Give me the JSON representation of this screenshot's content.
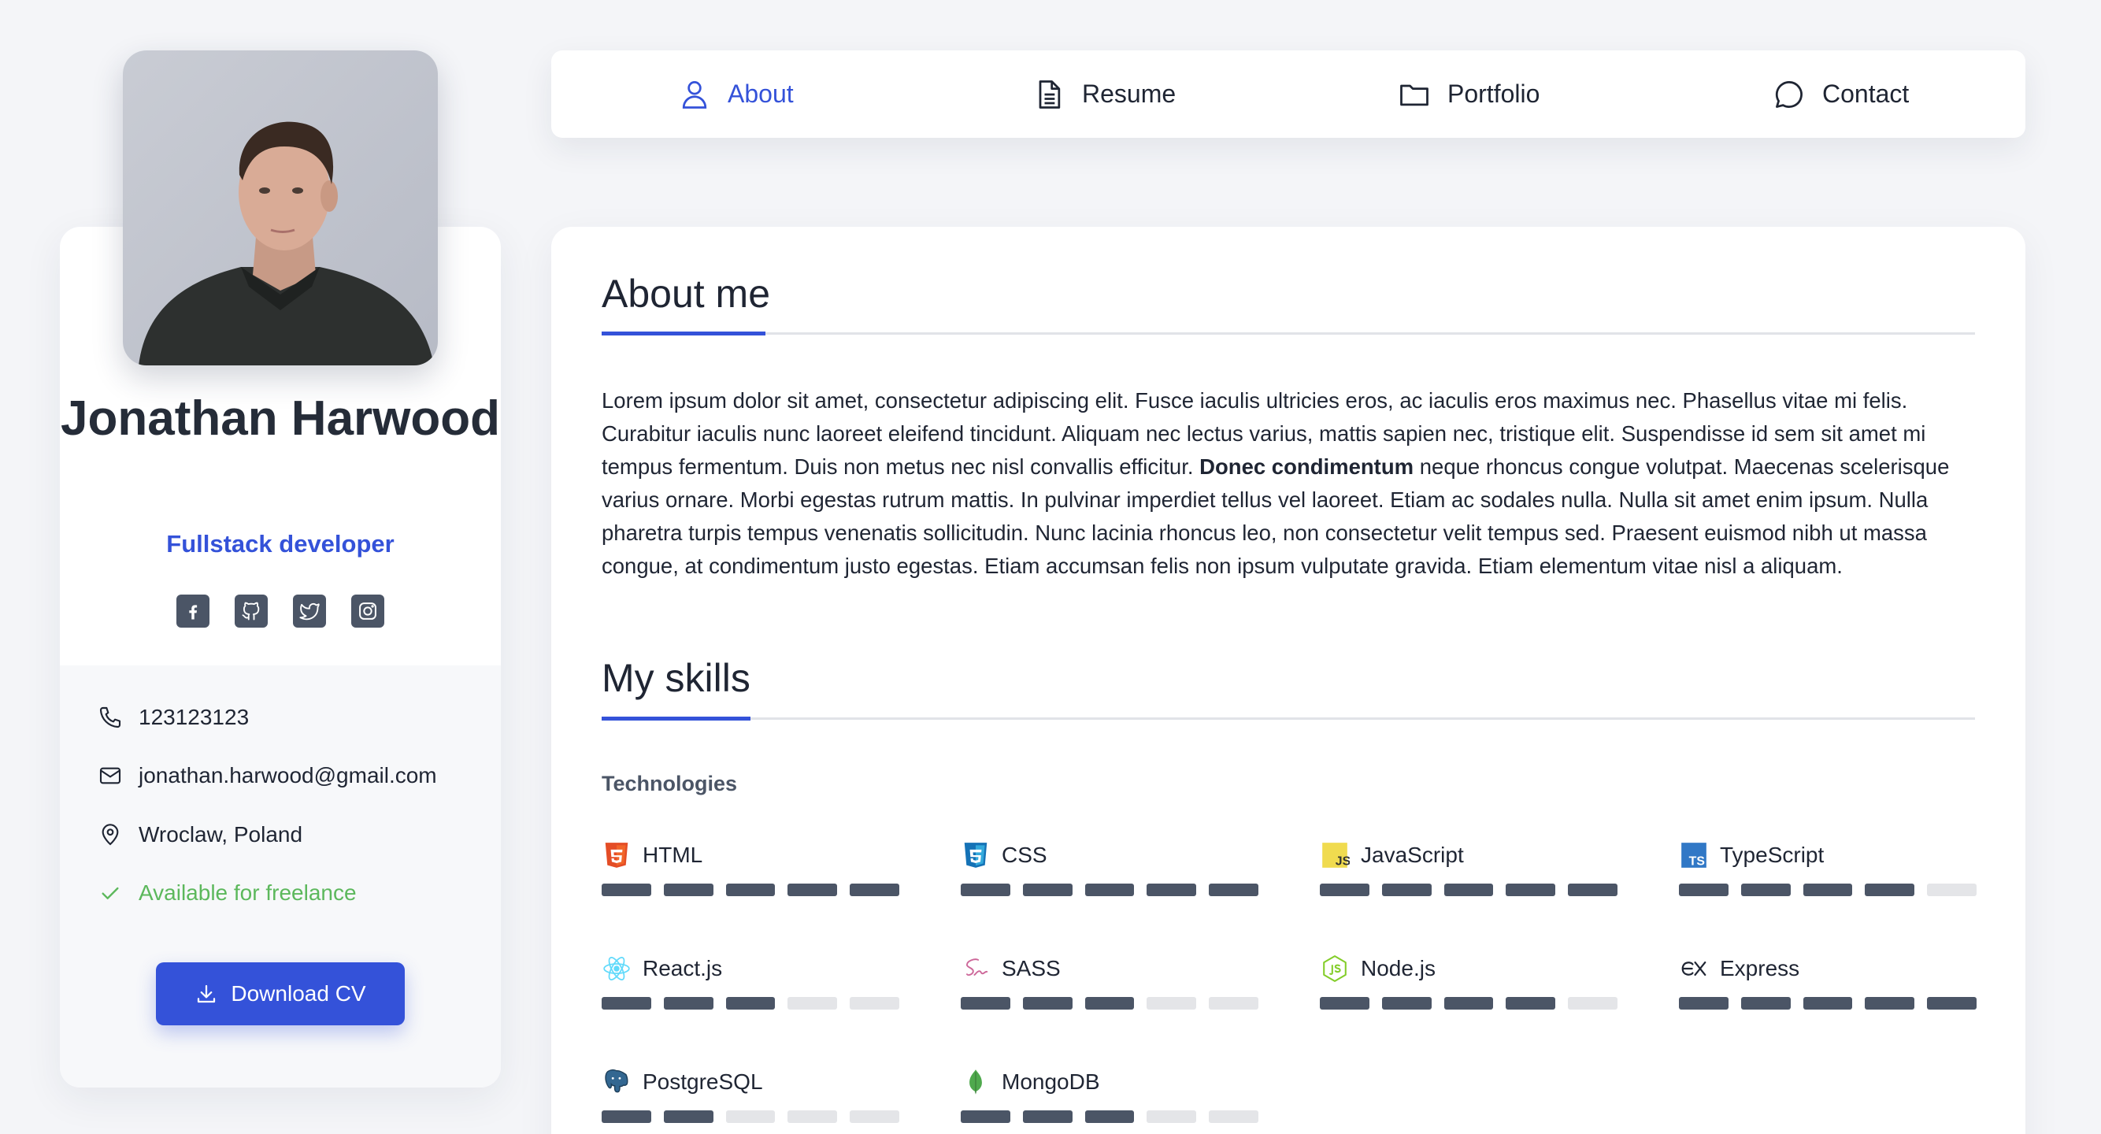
{
  "profile": {
    "name": "Jonathan Harwood",
    "role": "Fullstack developer",
    "socials": [
      {
        "icon": "facebook-icon"
      },
      {
        "icon": "github-icon"
      },
      {
        "icon": "twitter-icon"
      },
      {
        "icon": "instagram-icon"
      }
    ],
    "contact": {
      "phone": "123123123",
      "email": "jonathan.harwood@gmail.com",
      "location": "Wroclaw, Poland",
      "availability": "Available for freelance"
    },
    "download_label": "Download CV"
  },
  "nav": {
    "items": [
      {
        "label": "About",
        "icon": "user-icon",
        "active": true
      },
      {
        "label": "Resume",
        "icon": "document-icon",
        "active": false
      },
      {
        "label": "Portfolio",
        "icon": "folder-icon",
        "active": false
      },
      {
        "label": "Contact",
        "icon": "chat-icon",
        "active": false
      }
    ]
  },
  "about": {
    "title": "About me",
    "text_before": "Lorem ipsum dolor sit amet, consectetur adipiscing elit. Fusce iaculis ultricies eros, ac iaculis eros maximus nec. Phasellus vitae mi felis. Curabitur iaculis nunc laoreet eleifend tincidunt. Aliquam nec lectus varius, mattis sapien nec, tristique elit. Suspendisse id sem sit amet mi tempus fermentum. Duis non metus nec nisl convallis efficitur. ",
    "text_bold": "Donec condimentum",
    "text_after": " neque rhoncus congue volutpat. Maecenas scelerisque varius ornare. Morbi egestas rutrum mattis. In pulvinar imperdiet tellus vel laoreet. Etiam ac sodales nulla. Nulla sit amet enim ipsum. Nulla pharetra turpis tempus venenatis sollicitudin. Nunc lacinia rhoncus leo, non consectetur velit tempus sed. Praesent euismod nibh ut massa congue, at condimentum justo egestas. Etiam accumsan felis non ipsum vulputate gravida. Etiam elementum vitae nisl a aliquam."
  },
  "skills": {
    "title": "My skills",
    "category": "Technologies",
    "items": [
      {
        "name": "HTML",
        "icon": "html5-icon",
        "level": 5,
        "max": 5
      },
      {
        "name": "CSS",
        "icon": "css3-icon",
        "level": 5,
        "max": 5
      },
      {
        "name": "JavaScript",
        "icon": "javascript-icon",
        "level": 5,
        "max": 5
      },
      {
        "name": "TypeScript",
        "icon": "typescript-icon",
        "level": 4,
        "max": 5
      },
      {
        "name": "React.js",
        "icon": "react-icon",
        "level": 3,
        "max": 5
      },
      {
        "name": "SASS",
        "icon": "sass-icon",
        "level": 3,
        "max": 5
      },
      {
        "name": "Node.js",
        "icon": "nodejs-icon",
        "level": 4,
        "max": 5
      },
      {
        "name": "Express",
        "icon": "express-icon",
        "level": 5,
        "max": 5
      },
      {
        "name": "PostgreSQL",
        "icon": "postgresql-icon",
        "level": 2,
        "max": 5
      },
      {
        "name": "MongoDB",
        "icon": "mongodb-icon",
        "level": 3,
        "max": 5
      }
    ]
  },
  "colors": {
    "accent": "#3452d9",
    "success": "#5cb85c",
    "bar_filled": "#4b5566",
    "bar_empty": "#e4e5e8"
  }
}
